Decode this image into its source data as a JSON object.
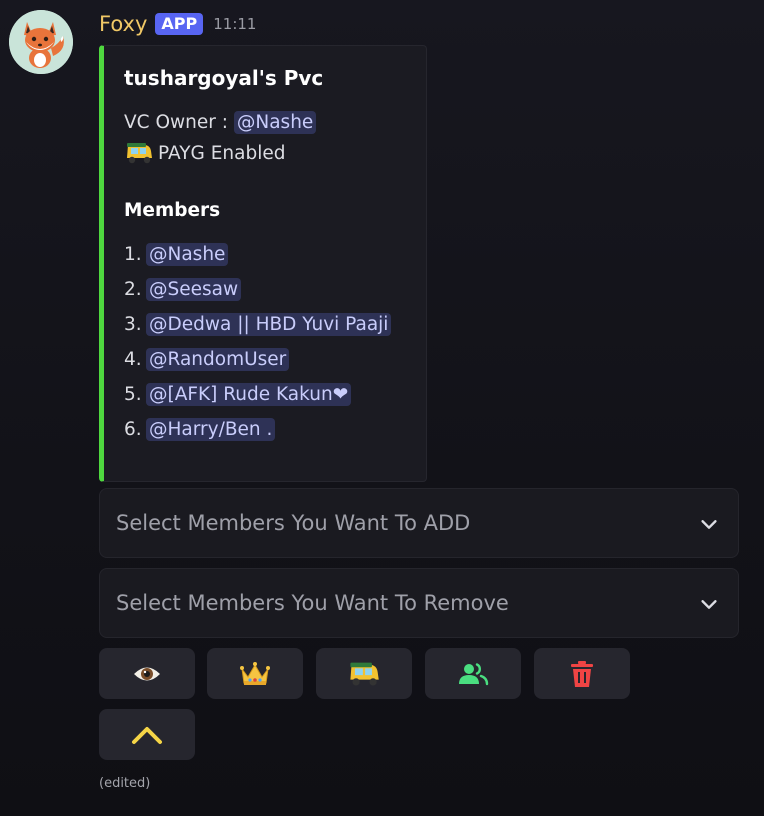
{
  "message": {
    "author": "Foxy",
    "badge": "APP",
    "timestamp": "11:11",
    "edited_label": "(edited)",
    "avatar_icon": "fox-mascot-icon"
  },
  "embed": {
    "accent_color": "#4fd83f",
    "title": "tushargoyal's Pvc",
    "owner_label": "VC Owner :",
    "owner_mention": "@Nashe",
    "payg_emoji": "auto-rickshaw-emoji",
    "payg_text": "PAYG Enabled",
    "members_heading": "Members",
    "members": [
      {
        "num": "1.",
        "mention": "@Nashe"
      },
      {
        "num": "2.",
        "mention": "@Seesaw"
      },
      {
        "num": "3.",
        "mention": "@Dedwa || HBD Yuvi Paaji"
      },
      {
        "num": "4.",
        "mention": "@RandomUser"
      },
      {
        "num": "5.",
        "mention": "@[AFK] Rude Kakun❤"
      },
      {
        "num": "6.",
        "mention": "@Harry/Ben ."
      }
    ]
  },
  "selects": {
    "add_placeholder": "Select Members You Want To ADD",
    "remove_placeholder": "Select Members You Want To Remove"
  },
  "buttons": [
    {
      "icon": "eye-icon"
    },
    {
      "icon": "crown-icon"
    },
    {
      "icon": "auto-rickshaw-icon"
    },
    {
      "icon": "users-icon",
      "color": "#4ade80"
    },
    {
      "icon": "trash-icon",
      "color": "#ef4444"
    },
    {
      "icon": "chevron-up-icon",
      "color": "#f5d547"
    }
  ]
}
